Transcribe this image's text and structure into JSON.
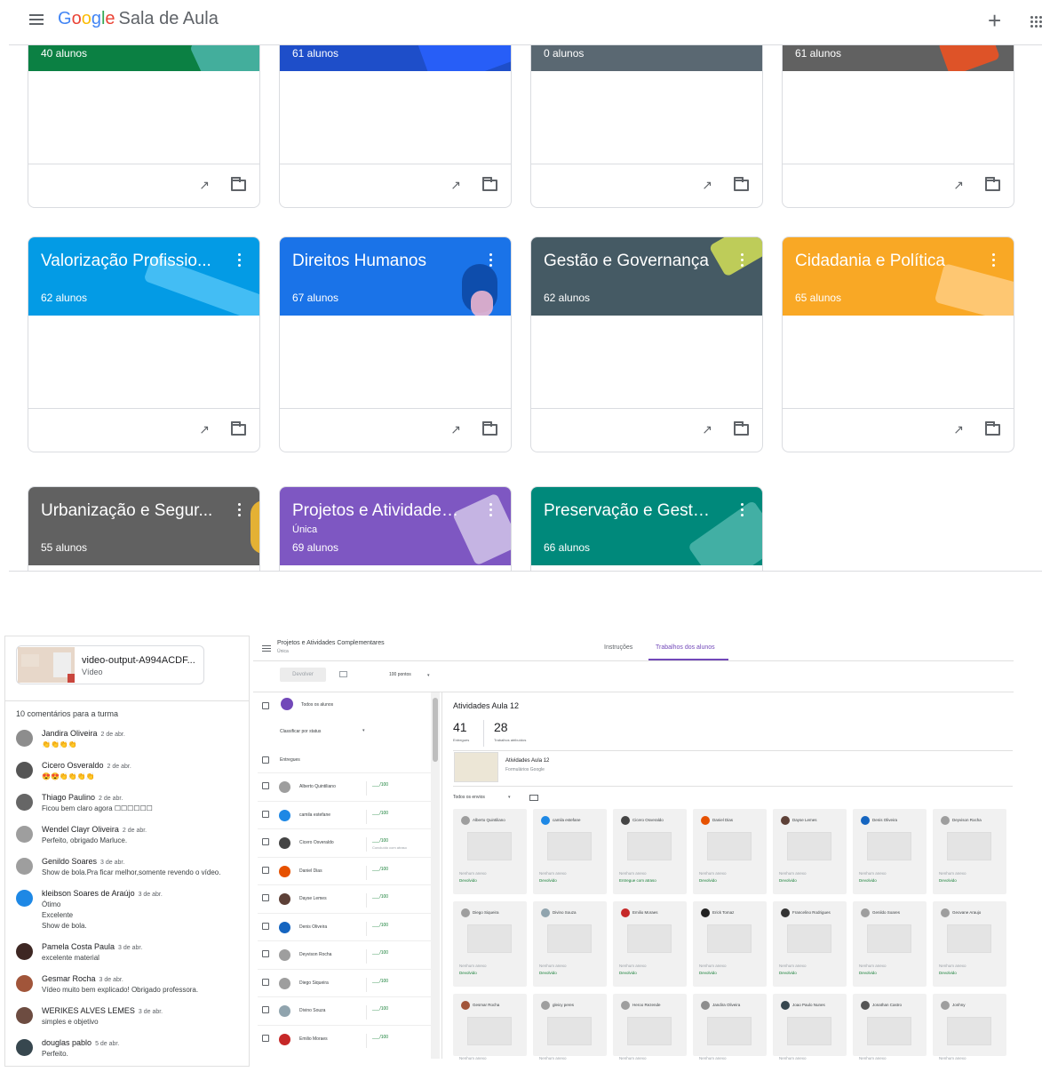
{
  "header": {
    "app_name_google": "Google",
    "app_name": "Sala de Aula",
    "plus_icon": "+"
  },
  "cards_top": [
    {
      "count": "40 alunos",
      "color": "#0b8043"
    },
    {
      "count": "61 alunos",
      "color": "#1e4ec9"
    },
    {
      "count": "0 alunos",
      "color": "#5a6872"
    },
    {
      "count": "61 alunos",
      "color": "#616161"
    }
  ],
  "cards_mid": [
    {
      "title": "Valorização Profissio...",
      "count": "62 alunos",
      "color": "#039be5"
    },
    {
      "title": "Direitos Humanos",
      "count": "67 alunos",
      "color": "#1a73e8"
    },
    {
      "title": "Gestão e Governança",
      "count": "62 alunos",
      "color": "#455a64"
    },
    {
      "title": "Cidadania e Política",
      "count": "65 alunos",
      "color": "#f9a825"
    }
  ],
  "cards_bot": [
    {
      "title": "Urbanização e Segur...",
      "count": "55 alunos",
      "sub": "",
      "color": "#616161"
    },
    {
      "title": "Projetos e Atividades ...",
      "count": "69 alunos",
      "sub": "Única",
      "color": "#7e57c2"
    },
    {
      "title": "Preservação e Gestã...",
      "count": "66 alunos",
      "sub": "",
      "color": "#00897b"
    }
  ],
  "comments_panel": {
    "attachment_name": "video-output-A994ACDF...",
    "attachment_kind": "Vídeo",
    "count_label": "10 comentários para a turma",
    "comments": [
      {
        "name": "Jandira Oliveira",
        "date": "2 de abr.",
        "text": "👏👏👏👏",
        "avatar": "#8d8d8d"
      },
      {
        "name": "Cicero Osveraldo",
        "date": "2 de abr.",
        "text": "😍😍👏👏👏👏",
        "avatar": "#555"
      },
      {
        "name": "Thiago Paulino",
        "date": "2 de abr.",
        "text": "Ficou bem claro agora ☐☐☐☐☐☐",
        "avatar": "#666"
      },
      {
        "name": "Wendel Clayr Oliveira",
        "date": "2 de abr.",
        "text": "Perfeito, obrigado Marluce.",
        "avatar": "#9e9e9e"
      },
      {
        "name": "Genildo Soares",
        "date": "3 de abr.",
        "text": "Show de bola.Pra ficar melhor,somente revendo o vídeo.",
        "avatar": "#9e9e9e"
      },
      {
        "name": "kleibson Soares de Araújo",
        "date": "3 de abr.",
        "text": "Ótimo\nExcelente\nShow de bola.",
        "avatar": "#1e88e5"
      },
      {
        "name": "Pamela Costa Paula",
        "date": "3 de abr.",
        "text": "excelente material",
        "avatar": "#3e2723"
      },
      {
        "name": "Gesmar Rocha",
        "date": "3 de abr.",
        "text": "Vídeo muito bem explicado! Obrigado professora.",
        "avatar": "#a1553a"
      },
      {
        "name": "WERIKES ALVES LEMES",
        "date": "3 de abr.",
        "text": "simples e objetivo",
        "avatar": "#6d4c41"
      },
      {
        "name": "douglas pablo",
        "date": "5 de abr.",
        "text": "Perfeito.",
        "avatar": "#37474f"
      }
    ]
  },
  "grading": {
    "title": "Projetos e Atividades Complementares",
    "subtitle": "Única",
    "tab_instructions": "Instruções",
    "tab_student_work": "Trabalhos dos alunos",
    "return_button": "Devolver",
    "points": "100 pontos",
    "all_students": "Todos os alunos",
    "sort_label": "Classificar por status",
    "group_label": "Entregues",
    "students": [
      {
        "name": "Alberto Quintiliano",
        "score": "___/100",
        "note": "",
        "avatar": "#9e9e9e"
      },
      {
        "name": "camila estefane",
        "score": "___/100",
        "note": "",
        "avatar": "#1e88e5"
      },
      {
        "name": "Cicero Osveraldo",
        "score": "___/100",
        "note": "Concluído com atraso",
        "avatar": "#444"
      },
      {
        "name": "Daniel Dias",
        "score": "___/100",
        "note": "",
        "avatar": "#e65100"
      },
      {
        "name": "Dayse Lemes",
        "score": "___/100",
        "note": "",
        "avatar": "#5d4037"
      },
      {
        "name": "Denis Oliveira",
        "score": "___/100",
        "note": "",
        "avatar": "#1565c0"
      },
      {
        "name": "Deyvison Rocha",
        "score": "___/100",
        "note": "",
        "avatar": "#9e9e9e"
      },
      {
        "name": "Diego Siqueira",
        "score": "___/100",
        "note": "",
        "avatar": "#9e9e9e"
      },
      {
        "name": "Divino Souza",
        "score": "___/100",
        "note": "",
        "avatar": "#90a4ae"
      },
      {
        "name": "Emilio Moraes",
        "score": "___/100",
        "note": "",
        "avatar": "#c62828"
      }
    ],
    "assignment_title": "Atividades Aula 12",
    "turned_in": "41",
    "turned_in_label": "Entregues",
    "assigned": "28",
    "assigned_label": "Trabalhos atribuídos",
    "form_name": "Atividades Aula 12",
    "form_kind": "Formulários Google",
    "filter": "Todos os envios",
    "no_attachment": "Nenhum anexo",
    "tiles": [
      {
        "name": "Alberto Quintiliano",
        "status": "Devolvido",
        "avatar": "#9e9e9e"
      },
      {
        "name": "camila estefane",
        "status": "Devolvido",
        "avatar": "#1e88e5"
      },
      {
        "name": "Cicero Osveraldo",
        "status": "Entregue com atraso",
        "avatar": "#444"
      },
      {
        "name": "Daniel Dias",
        "status": "Devolvido",
        "avatar": "#e65100"
      },
      {
        "name": "Dayse Lemes",
        "status": "Devolvido",
        "avatar": "#5d4037"
      },
      {
        "name": "Denis Oliveira",
        "status": "Devolvido",
        "avatar": "#1565c0"
      },
      {
        "name": "Deyvison Rocha",
        "status": "Devolvido",
        "avatar": "#9e9e9e"
      },
      {
        "name": "Diego Siqueira",
        "status": "Devolvido",
        "avatar": "#9e9e9e"
      },
      {
        "name": "Divino Souza",
        "status": "Devolvido",
        "avatar": "#90a4ae"
      },
      {
        "name": "Emilio Moraes",
        "status": "Devolvido",
        "avatar": "#c62828"
      },
      {
        "name": "Erick Tomaz",
        "status": "Devolvido",
        "avatar": "#212121"
      },
      {
        "name": "Francelino Rodrigues",
        "status": "Devolvido",
        "avatar": "#333"
      },
      {
        "name": "Genildo Soares",
        "status": "Devolvido",
        "avatar": "#9e9e9e"
      },
      {
        "name": "Geovane Araujo",
        "status": "Devolvido",
        "avatar": "#9e9e9e"
      },
      {
        "name": "Gesmar Rocha",
        "status": "",
        "avatar": "#a1553a"
      },
      {
        "name": "gleicy peres",
        "status": "",
        "avatar": "#9e9e9e"
      },
      {
        "name": "Heroo Rezende",
        "status": "",
        "avatar": "#9e9e9e"
      },
      {
        "name": "Jandira Oliveira",
        "status": "",
        "avatar": "#8d8d8d"
      },
      {
        "name": "Joao Paulo Nunes",
        "status": "",
        "avatar": "#37474f"
      },
      {
        "name": "Jonathan Castro",
        "status": "",
        "avatar": "#555"
      },
      {
        "name": "Jonhny",
        "status": "",
        "avatar": "#9e9e9e"
      }
    ]
  }
}
